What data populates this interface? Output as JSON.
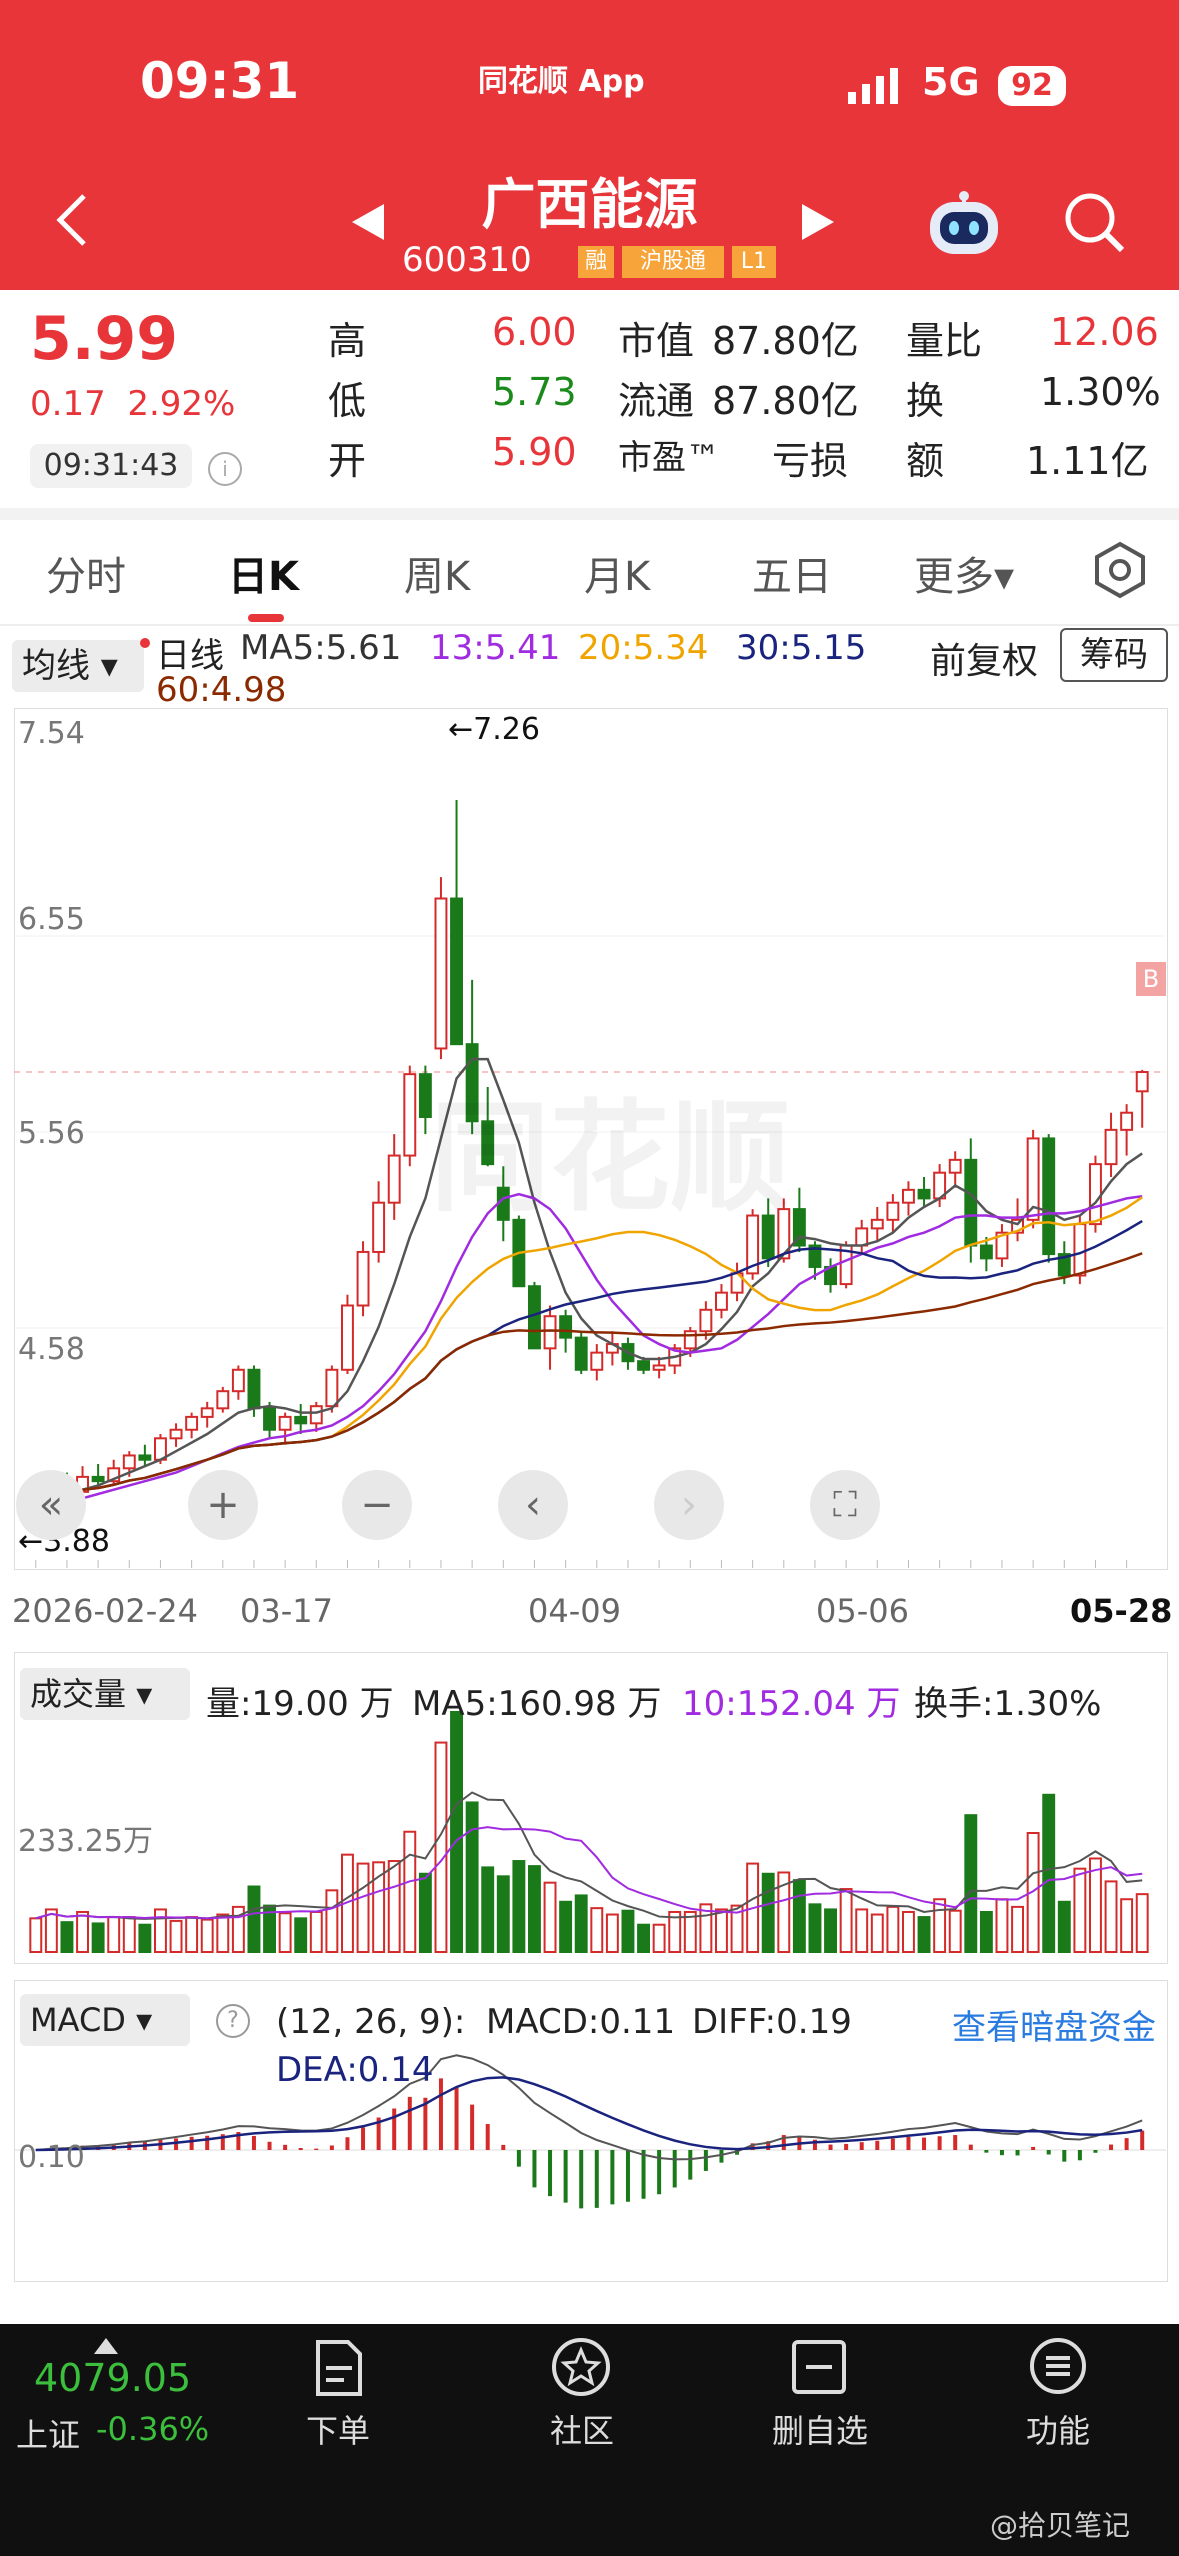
{
  "status": {
    "time": "09:31",
    "app": "同花顺 App",
    "network": "5G",
    "battery": "92"
  },
  "stock": {
    "name": "广西能源",
    "code": "600310",
    "tags": [
      "融",
      "沪股通",
      "L1"
    ]
  },
  "quote": {
    "price": "5.99",
    "change": "0.17",
    "change_pct": "2.92%",
    "time": "09:31:43",
    "high_label": "高",
    "high": "6.00",
    "low_label": "低",
    "low": "5.73",
    "open_label": "开",
    "open": "5.90",
    "mcap_label": "市值",
    "mcap": "87.80亿",
    "float_label": "流通",
    "float": "87.80亿",
    "pe_label": "市盈™",
    "pe": "亏损",
    "vr_label": "量比",
    "vr": "12.06",
    "turn_label": "换",
    "turn": "1.30%",
    "amt_label": "额",
    "amt": "1.11亿"
  },
  "tabs": [
    "分时",
    "日K",
    "周K",
    "月K",
    "五日",
    "更多▾"
  ],
  "ma": {
    "button": "均线",
    "daily": "日线",
    "ma5": "MA5:5.61",
    "ma13": "13:5.41",
    "ma20": "20:5.34",
    "ma30": "30:5.15",
    "ma60": "60:4.98",
    "fuquan": "前复权",
    "chouma": "筹码"
  },
  "kchart": {
    "y_ticks": [
      "7.54",
      "6.55",
      "5.56",
      "4.58"
    ],
    "hi_label": "←7.26",
    "lo_label": "←3.88",
    "b_mark": "B",
    "dates": [
      "2026-02-24",
      "03-17",
      "04-09",
      "05-06",
      "05-28"
    ],
    "watermark": "同花顺"
  },
  "volume": {
    "button": "成交量",
    "vol": "量:19.00 万",
    "ma5": "MA5:160.98 万",
    "ma10": "10:152.04 万",
    "turnover": "换手:1.30%",
    "y_tick": "233.25万"
  },
  "macd": {
    "button": "MACD",
    "params": "(12, 26, 9):",
    "macd": "MACD:0.11",
    "diff": "DIFF:0.19",
    "dea": "DEA:0.14",
    "y_tick": "0.10",
    "link": "查看暗盘资金"
  },
  "nav": {
    "index_value": "4079.05",
    "index_name": "上证",
    "index_change": "-0.36%",
    "items": [
      "下单",
      "社区",
      "删自选",
      "功能"
    ],
    "watermark": "@拾贝笔记"
  },
  "colors": {
    "brand": "#e8353a",
    "up": "#d42a2a",
    "down": "#1a7a1a",
    "ma5": "#555555",
    "ma13": "#a02be0",
    "ma20": "#f0a400",
    "ma30": "#1a237e",
    "ma60": "#8b2a00"
  },
  "chart_data": {
    "type": "candlestick",
    "title": "广西能源 600310 日K",
    "ylim": [
      3.88,
      7.54
    ],
    "x_labels": [
      "2026-02-24",
      "03-17",
      "04-09",
      "05-06",
      "05-28"
    ],
    "candles": [
      [
        3.92,
        4.0,
        3.88,
        3.97
      ],
      [
        3.97,
        4.1,
        3.95,
        4.06
      ],
      [
        4.06,
        4.12,
        4.01,
        4.03
      ],
      [
        4.03,
        4.15,
        4.0,
        4.1
      ],
      [
        4.1,
        4.16,
        4.05,
        4.08
      ],
      [
        4.08,
        4.18,
        4.06,
        4.14
      ],
      [
        4.14,
        4.22,
        4.1,
        4.2
      ],
      [
        4.2,
        4.25,
        4.15,
        4.18
      ],
      [
        4.18,
        4.3,
        4.16,
        4.28
      ],
      [
        4.28,
        4.35,
        4.24,
        4.32
      ],
      [
        4.32,
        4.4,
        4.28,
        4.38
      ],
      [
        4.38,
        4.45,
        4.33,
        4.42
      ],
      [
        4.42,
        4.52,
        4.4,
        4.5
      ],
      [
        4.5,
        4.62,
        4.46,
        4.6
      ],
      [
        4.6,
        4.62,
        4.38,
        4.42
      ],
      [
        4.42,
        4.45,
        4.28,
        4.32
      ],
      [
        4.32,
        4.4,
        4.25,
        4.38
      ],
      [
        4.38,
        4.44,
        4.3,
        4.35
      ],
      [
        4.35,
        4.45,
        4.31,
        4.43
      ],
      [
        4.43,
        4.62,
        4.4,
        4.6
      ],
      [
        4.6,
        4.95,
        4.58,
        4.9
      ],
      [
        4.9,
        5.2,
        4.85,
        5.15
      ],
      [
        5.15,
        5.48,
        5.1,
        5.38
      ],
      [
        5.38,
        5.7,
        5.3,
        5.6
      ],
      [
        5.6,
        6.02,
        5.55,
        5.98
      ],
      [
        5.98,
        6.02,
        5.7,
        5.78
      ],
      [
        6.1,
        6.9,
        6.05,
        6.8
      ],
      [
        6.8,
        7.26,
        6.15,
        6.12
      ],
      [
        6.12,
        6.42,
        5.7,
        5.76
      ],
      [
        5.76,
        5.92,
        5.55,
        5.56
      ],
      [
        5.45,
        5.55,
        5.2,
        5.3
      ],
      [
        5.3,
        5.32,
        5.01,
        4.99
      ],
      [
        4.99,
        5.01,
        4.72,
        4.7
      ],
      [
        4.7,
        4.9,
        4.6,
        4.85
      ],
      [
        4.85,
        4.88,
        4.68,
        4.75
      ],
      [
        4.75,
        4.78,
        4.58,
        4.6
      ],
      [
        4.6,
        4.72,
        4.55,
        4.68
      ],
      [
        4.68,
        4.78,
        4.62,
        4.72
      ],
      [
        4.72,
        4.75,
        4.6,
        4.64
      ],
      [
        4.64,
        4.66,
        4.58,
        4.6
      ],
      [
        4.6,
        4.66,
        4.56,
        4.62
      ],
      [
        4.62,
        4.72,
        4.58,
        4.7
      ],
      [
        4.7,
        4.8,
        4.66,
        4.78
      ],
      [
        4.78,
        4.92,
        4.74,
        4.88
      ],
      [
        4.88,
        5.0,
        4.84,
        4.96
      ],
      [
        4.96,
        5.1,
        4.92,
        5.05
      ],
      [
        5.05,
        5.35,
        5.02,
        5.32
      ],
      [
        5.32,
        5.4,
        5.08,
        5.12
      ],
      [
        5.12,
        5.4,
        5.1,
        5.35
      ],
      [
        5.35,
        5.45,
        5.15,
        5.18
      ],
      [
        5.18,
        5.2,
        5.02,
        5.08
      ],
      [
        5.08,
        5.12,
        4.96,
        5.0
      ],
      [
        5.0,
        5.2,
        4.98,
        5.18
      ],
      [
        5.18,
        5.3,
        5.14,
        5.26
      ],
      [
        5.26,
        5.36,
        5.2,
        5.3
      ],
      [
        5.3,
        5.42,
        5.24,
        5.38
      ],
      [
        5.38,
        5.48,
        5.32,
        5.44
      ],
      [
        5.44,
        5.5,
        5.36,
        5.4
      ],
      [
        5.4,
        5.56,
        5.36,
        5.52
      ],
      [
        5.52,
        5.62,
        5.45,
        5.58
      ],
      [
        5.58,
        5.68,
        5.1,
        5.18
      ],
      [
        5.18,
        5.22,
        5.06,
        5.12
      ],
      [
        5.12,
        5.28,
        5.08,
        5.24
      ],
      [
        5.24,
        5.4,
        5.2,
        5.3
      ],
      [
        5.3,
        5.72,
        5.26,
        5.68
      ],
      [
        5.68,
        5.7,
        5.1,
        5.14
      ],
      [
        5.14,
        5.2,
        5.0,
        5.04
      ],
      [
        5.04,
        5.32,
        5.0,
        5.28
      ],
      [
        5.28,
        5.6,
        5.24,
        5.56
      ],
      [
        5.56,
        5.8,
        5.5,
        5.72
      ],
      [
        5.72,
        5.84,
        5.6,
        5.8
      ],
      [
        5.9,
        6.0,
        5.73,
        5.99
      ]
    ],
    "series": [
      {
        "name": "MA5",
        "values": [
          3.95,
          3.99,
          4.01,
          4.04,
          4.06,
          4.09,
          4.12,
          4.15,
          4.18,
          4.22,
          4.26,
          4.3,
          4.35,
          4.4,
          4.42,
          4.43,
          4.42,
          4.4,
          4.4,
          4.42,
          4.5,
          4.64,
          4.8,
          5.0,
          5.22,
          5.4,
          5.68,
          5.96,
          6.05,
          6.05,
          5.86,
          5.66,
          5.38,
          5.15,
          4.96,
          4.84,
          4.76,
          4.72,
          4.68,
          4.65,
          4.65,
          4.66,
          4.68,
          4.72,
          4.79,
          4.87,
          4.99,
          5.05,
          5.14,
          5.22,
          5.21,
          5.19,
          5.18,
          5.18,
          5.2,
          5.24,
          5.31,
          5.36,
          5.4,
          5.46,
          5.42,
          5.34,
          5.3,
          5.28,
          5.36,
          5.34,
          5.3,
          5.32,
          5.38,
          5.48,
          5.56,
          5.61
        ]
      },
      {
        "name": "13",
        "values": [
          3.95,
          3.97,
          3.98,
          4.0,
          4.02,
          4.04,
          4.06,
          4.08,
          4.1,
          4.12,
          4.15,
          4.18,
          4.21,
          4.24,
          4.26,
          4.28,
          4.29,
          4.31,
          4.32,
          4.34,
          4.38,
          4.43,
          4.5,
          4.58,
          4.68,
          4.78,
          4.92,
          5.08,
          5.22,
          5.33,
          5.4,
          5.42,
          5.4,
          5.35,
          5.26,
          5.14,
          5.02,
          4.92,
          4.84,
          4.76,
          4.72,
          4.69,
          4.68,
          4.69,
          4.7,
          4.74,
          4.8,
          4.86,
          4.93,
          5.0,
          5.04,
          5.08,
          5.11,
          5.14,
          5.17,
          5.19,
          5.22,
          5.24,
          5.27,
          5.31,
          5.32,
          5.32,
          5.31,
          5.31,
          5.32,
          5.33,
          5.33,
          5.34,
          5.36,
          5.38,
          5.4,
          5.41
        ]
      }
    ]
  }
}
